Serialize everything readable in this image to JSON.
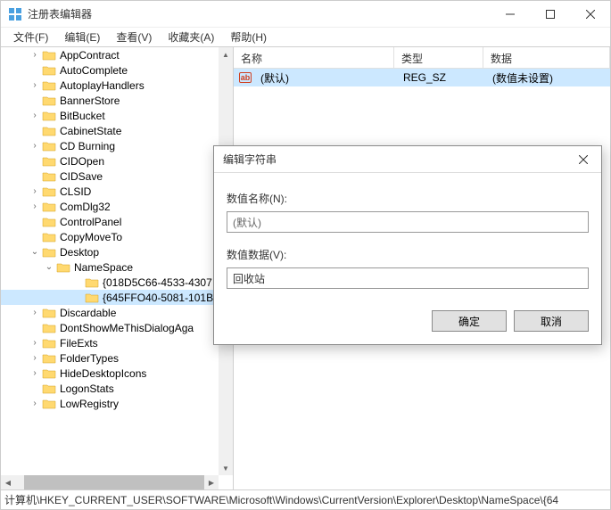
{
  "window": {
    "title": "注册表编辑器"
  },
  "menu": {
    "file": "文件(F)",
    "edit": "编辑(E)",
    "view": "查看(V)",
    "favorites": "收藏夹(A)",
    "help": "帮助(H)"
  },
  "tree": {
    "items": [
      {
        "label": "AppContract",
        "indent": 2,
        "exp": "collapsed"
      },
      {
        "label": "AutoComplete",
        "indent": 2,
        "exp": "none"
      },
      {
        "label": "AutoplayHandlers",
        "indent": 2,
        "exp": "collapsed"
      },
      {
        "label": "BannerStore",
        "indent": 2,
        "exp": "none"
      },
      {
        "label": "BitBucket",
        "indent": 2,
        "exp": "collapsed"
      },
      {
        "label": "CabinetState",
        "indent": 2,
        "exp": "none"
      },
      {
        "label": "CD Burning",
        "indent": 2,
        "exp": "collapsed"
      },
      {
        "label": "CIDOpen",
        "indent": 2,
        "exp": "none"
      },
      {
        "label": "CIDSave",
        "indent": 2,
        "exp": "none"
      },
      {
        "label": "CLSID",
        "indent": 2,
        "exp": "collapsed"
      },
      {
        "label": "ComDlg32",
        "indent": 2,
        "exp": "collapsed"
      },
      {
        "label": "ControlPanel",
        "indent": 2,
        "exp": "none"
      },
      {
        "label": "CopyMoveTo",
        "indent": 2,
        "exp": "none"
      },
      {
        "label": "Desktop",
        "indent": 2,
        "exp": "expanded"
      },
      {
        "label": "NameSpace",
        "indent": 3,
        "exp": "expanded"
      },
      {
        "label": "{018D5C66-4533-4307",
        "indent": 4,
        "exp": "none"
      },
      {
        "label": "{645FFO40-5081-101B",
        "indent": 4,
        "exp": "none",
        "selected": true
      },
      {
        "label": "Discardable",
        "indent": 2,
        "exp": "collapsed"
      },
      {
        "label": "DontShowMeThisDialogAga",
        "indent": 2,
        "exp": "none"
      },
      {
        "label": "FileExts",
        "indent": 2,
        "exp": "collapsed"
      },
      {
        "label": "FolderTypes",
        "indent": 2,
        "exp": "collapsed"
      },
      {
        "label": "HideDesktopIcons",
        "indent": 2,
        "exp": "collapsed"
      },
      {
        "label": "LogonStats",
        "indent": 2,
        "exp": "none"
      },
      {
        "label": "LowRegistry",
        "indent": 2,
        "exp": "collapsed"
      }
    ]
  },
  "list": {
    "headers": {
      "name": "名称",
      "type": "类型",
      "data": "数据"
    },
    "rows": [
      {
        "name": "(默认)",
        "type": "REG_SZ",
        "data": "(数值未设置)",
        "selected": true
      }
    ]
  },
  "dialog": {
    "title": "编辑字符串",
    "name_label": "数值名称(N):",
    "name_value": "(默认)",
    "data_label": "数值数据(V):",
    "data_value": "回收站",
    "ok": "确定",
    "cancel": "取消"
  },
  "statusbar": {
    "path": "计算机\\HKEY_CURRENT_USER\\SOFTWARE\\Microsoft\\Windows\\CurrentVersion\\Explorer\\Desktop\\NameSpace\\{64"
  }
}
